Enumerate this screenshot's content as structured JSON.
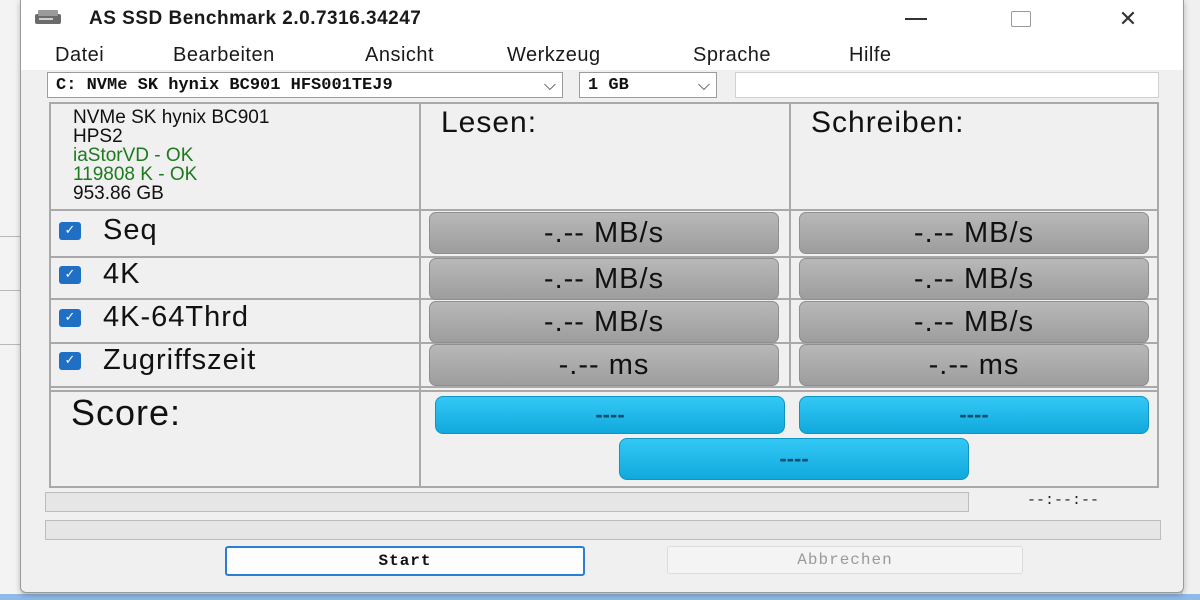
{
  "window": {
    "title": "AS SSD Benchmark 2.0.7316.34247",
    "icon": "drive-icon",
    "controls": [
      "minimize",
      "maximize",
      "close"
    ]
  },
  "menu": [
    "Datei",
    "Bearbeiten",
    "Ansicht",
    "Werkzeug",
    "Sprache",
    "Hilfe"
  ],
  "drive_select": {
    "value": "C: NVMe SK hynix BC901 HFS001TEJ9"
  },
  "size_select": {
    "value": "1 GB"
  },
  "drive_info": {
    "model": "NVMe SK hynix BC901",
    "firmware": "HPS2",
    "driver_status": "iaStorVD - OK",
    "alignment_status": "119808 K - OK",
    "capacity": "953.86 GB"
  },
  "columns": {
    "read": "Lesen:",
    "write": "Schreiben:"
  },
  "tests": [
    {
      "label": "Seq",
      "checked": true,
      "read": "-.-- MB/s",
      "write": "-.-- MB/s"
    },
    {
      "label": "4K",
      "checked": true,
      "read": "-.-- MB/s",
      "write": "-.-- MB/s"
    },
    {
      "label": "4K-64Thrd",
      "checked": true,
      "read": "-.-- MB/s",
      "write": "-.-- MB/s"
    },
    {
      "label": "Zugriffszeit",
      "checked": true,
      "read": "-.-- ms",
      "write": "-.-- ms"
    }
  ],
  "score": {
    "label": "Score:",
    "read": "----",
    "write": "----",
    "total": "----"
  },
  "progress": {
    "timer": "--:--:--",
    "value": 0
  },
  "buttons": {
    "start": "Start",
    "abort": "Abbrechen"
  },
  "colors": {
    "score_fill": "#1bb6e8",
    "result_fill": "#a9a9a9",
    "ok_text": "#1d7a1d",
    "checkbox": "#1f6fc5"
  }
}
